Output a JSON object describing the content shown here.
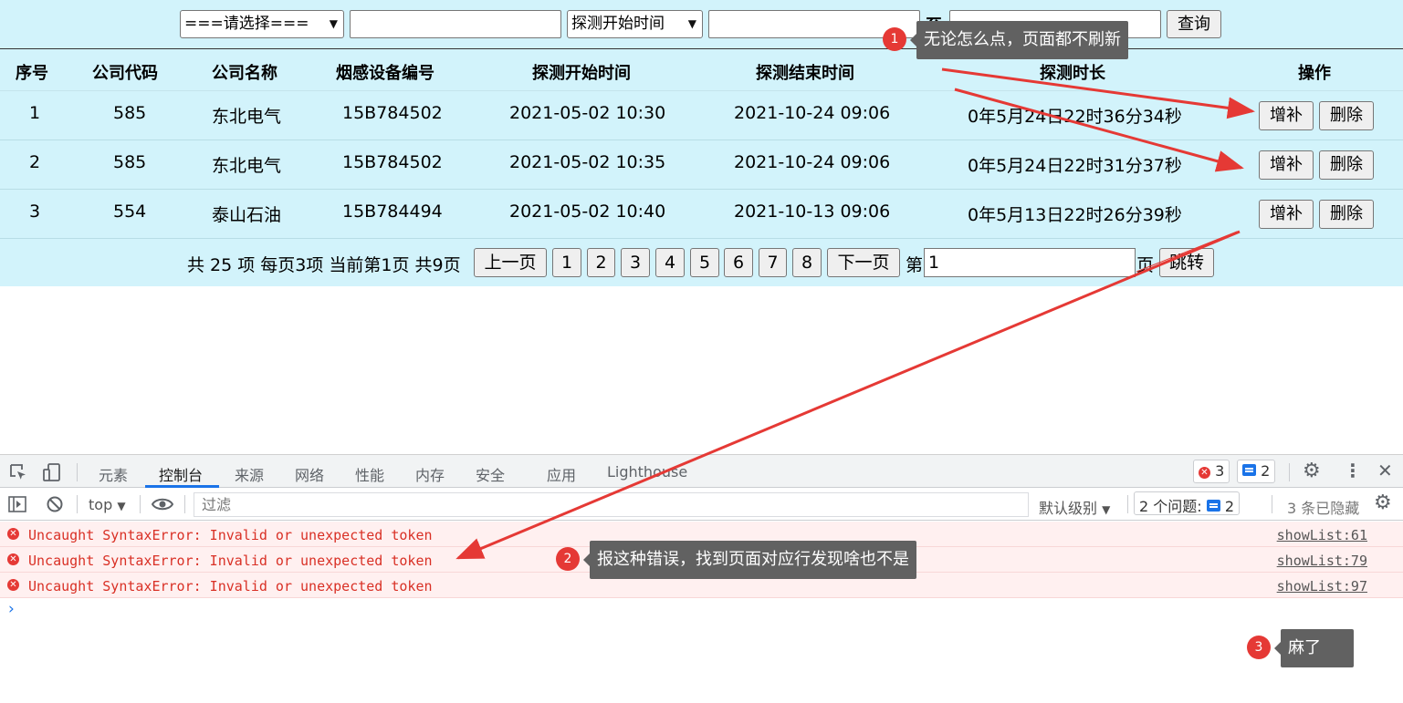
{
  "filter": {
    "select_company": "===请选择===",
    "company_input": "",
    "select_time_type": "探测开始时间",
    "date_from": "",
    "to_label": "至",
    "date_to": "",
    "query_button": "查询"
  },
  "table": {
    "headers": [
      "序号",
      "公司代码",
      "公司名称",
      "烟感设备编号",
      "探测开始时间",
      "探测结束时间",
      "探测时长",
      "操作"
    ],
    "rows": [
      {
        "no": "1",
        "code": "585",
        "name": "东北电气",
        "device": "15B784502",
        "start": "2021-05-02 10:30",
        "end": "2021-10-24 09:06",
        "duration": "0年5月24日22时36分34秒"
      },
      {
        "no": "2",
        "code": "585",
        "name": "东北电气",
        "device": "15B784502",
        "start": "2021-05-02 10:35",
        "end": "2021-10-24 09:06",
        "duration": "0年5月24日22时31分37秒"
      },
      {
        "no": "3",
        "code": "554",
        "name": "泰山石油",
        "device": "15B784494",
        "start": "2021-05-02 10:40",
        "end": "2021-10-13 09:06",
        "duration": "0年5月13日22时26分39秒"
      }
    ],
    "add_button": "增补",
    "delete_button": "删除"
  },
  "pager": {
    "summary": "共 25 项 每页3项 当前第1页 共9页",
    "prev": "上一页",
    "pages": [
      "1",
      "2",
      "3",
      "4",
      "5",
      "6",
      "7",
      "8"
    ],
    "next": "下一页",
    "goto_prefix": "第",
    "goto_value": "1",
    "goto_suffix": "页",
    "goto_button": "跳转"
  },
  "devtools": {
    "tabs": [
      "元素",
      "控制台",
      "来源",
      "网络",
      "性能",
      "内存",
      "安全",
      "应用",
      "Lighthouse"
    ],
    "active_tab": "控制台",
    "error_count": "3",
    "message_count": "2",
    "context": "top",
    "filter_placeholder": "过滤",
    "level": "默认级别",
    "issues_label": "2 个问题:",
    "issues_count": "2",
    "hidden": "3 条已隐藏",
    "messages": [
      {
        "text": "Uncaught SyntaxError: Invalid or unexpected token",
        "source": "showList:61"
      },
      {
        "text": "Uncaught SyntaxError: Invalid or unexpected token",
        "source": "showList:79"
      },
      {
        "text": "Uncaught SyntaxError: Invalid or unexpected token",
        "source": "showList:97"
      }
    ]
  },
  "annotations": [
    {
      "num": "1",
      "text": "无论怎么点，页面都不刷新"
    },
    {
      "num": "2",
      "text": "报这种错误，找到页面对应行发现啥也不是"
    },
    {
      "num": "3",
      "text": "麻了"
    }
  ],
  "colors": {
    "table_bg": "#d2f3fb",
    "error_red": "#d93025",
    "annotation_red": "#e53935",
    "annotation_box": "#616161",
    "link_blue": "#1a73e8"
  }
}
